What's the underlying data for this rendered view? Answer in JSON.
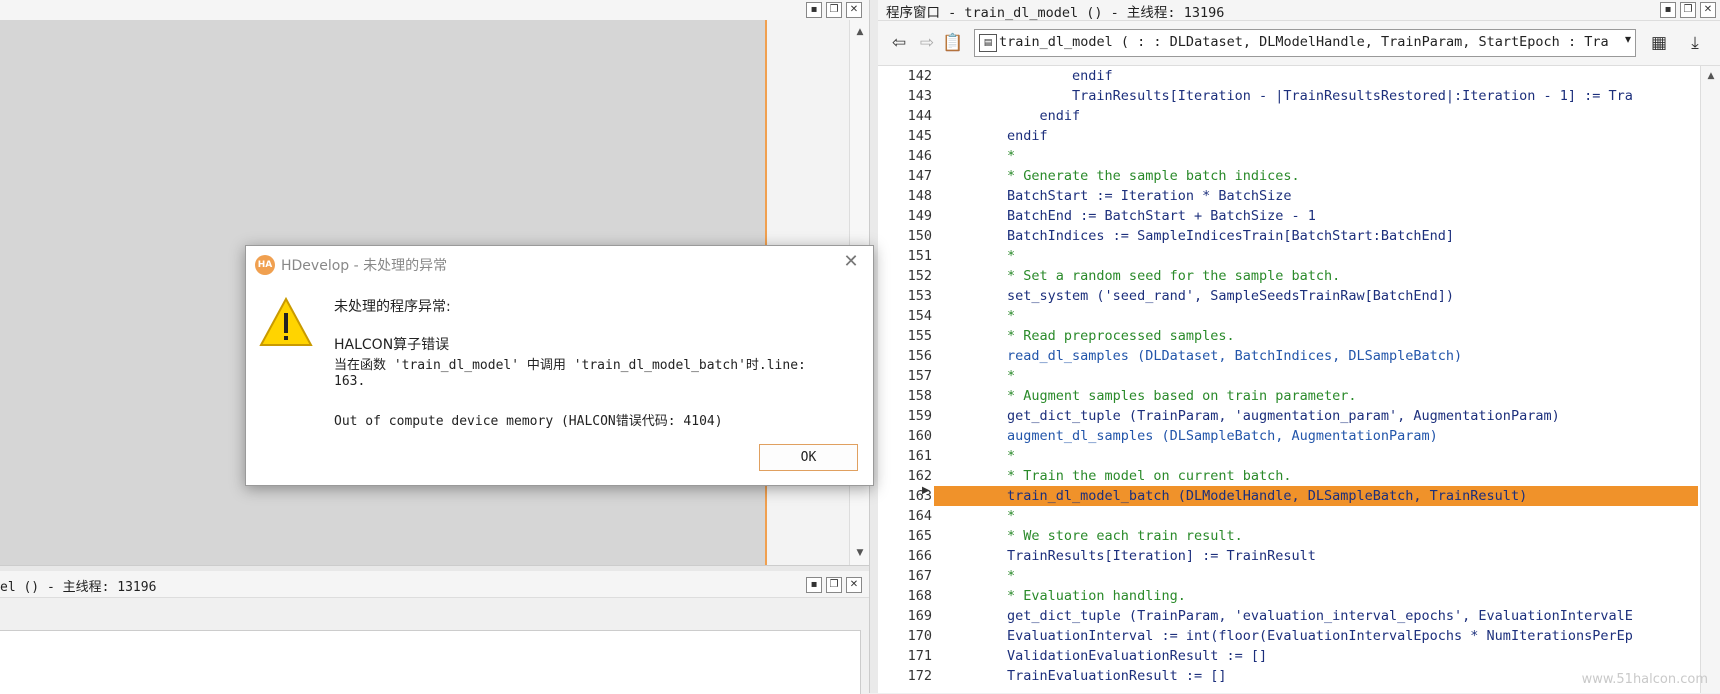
{
  "left_panel": {
    "bottom_title": "el () - 主线程: 13196"
  },
  "right_panel": {
    "title": "程序窗口 - train_dl_model () - 主线程: 13196",
    "procedure_selector": "train_dl_model ( : : DLDataset, DLModelHandle, TrainParam, StartEpoch : Trai",
    "highlighted_line": 163
  },
  "code_lines": [
    {
      "n": "142",
      "text": "                endif",
      "kind": "code"
    },
    {
      "n": "143",
      "text": "                TrainResults[Iteration - |TrainResultsRestored|:Iteration - 1] := Tra",
      "kind": "code"
    },
    {
      "n": "144",
      "text": "            endif",
      "kind": "code"
    },
    {
      "n": "145",
      "text": "        endif",
      "kind": "code"
    },
    {
      "n": "146",
      "text": "        *",
      "kind": "comment"
    },
    {
      "n": "147",
      "text": "        * Generate the sample batch indices.",
      "kind": "comment"
    },
    {
      "n": "148",
      "text": "        BatchStart := Iteration * BatchSize",
      "kind": "code"
    },
    {
      "n": "149",
      "text": "        BatchEnd := BatchStart + BatchSize - 1",
      "kind": "code"
    },
    {
      "n": "150",
      "text": "        BatchIndices := SampleIndicesTrain[BatchStart:BatchEnd]",
      "kind": "code"
    },
    {
      "n": "151",
      "text": "        *",
      "kind": "comment"
    },
    {
      "n": "152",
      "text": "        * Set a random seed for the sample batch.",
      "kind": "comment"
    },
    {
      "n": "153",
      "text": "        set_system ('seed_rand', SampleSeedsTrainRaw[BatchEnd])",
      "kind": "code"
    },
    {
      "n": "154",
      "text": "        *",
      "kind": "comment"
    },
    {
      "n": "155",
      "text": "        * Read preprocessed samples.",
      "kind": "comment"
    },
    {
      "n": "156",
      "text": "        read_dl_samples (DLDataset, BatchIndices, DLSampleBatch)",
      "kind": "proc"
    },
    {
      "n": "157",
      "text": "        *",
      "kind": "comment"
    },
    {
      "n": "158",
      "text": "        * Augment samples based on train parameter.",
      "kind": "comment"
    },
    {
      "n": "159",
      "text": "        get_dict_tuple (TrainParam, 'augmentation_param', AugmentationParam)",
      "kind": "code"
    },
    {
      "n": "160",
      "text": "        augment_dl_samples (DLSampleBatch, AugmentationParam)",
      "kind": "proc"
    },
    {
      "n": "161",
      "text": "        *",
      "kind": "comment"
    },
    {
      "n": "162",
      "text": "        * Train the model on current batch.",
      "kind": "comment"
    },
    {
      "n": "163",
      "text": "        train_dl_model_batch (DLModelHandle, DLSampleBatch, TrainResult)",
      "kind": "code"
    },
    {
      "n": "164",
      "text": "        *",
      "kind": "comment"
    },
    {
      "n": "165",
      "text": "        * We store each train result.",
      "kind": "comment"
    },
    {
      "n": "166",
      "text": "        TrainResults[Iteration] := TrainResult",
      "kind": "code"
    },
    {
      "n": "167",
      "text": "        *",
      "kind": "comment"
    },
    {
      "n": "168",
      "text": "        * Evaluation handling.",
      "kind": "comment"
    },
    {
      "n": "169",
      "text": "        get_dict_tuple (TrainParam, 'evaluation_interval_epochs', EvaluationIntervalE",
      "kind": "code"
    },
    {
      "n": "170",
      "text": "        EvaluationInterval := int(floor(EvaluationIntervalEpochs * NumIterationsPerEp",
      "kind": "code"
    },
    {
      "n": "171",
      "text": "        ValidationEvaluationResult := []",
      "kind": "code"
    },
    {
      "n": "172",
      "text": "        TrainEvaluationResult := []",
      "kind": "code"
    }
  ],
  "dialog": {
    "title": "HDevelop - 未处理的异常",
    "logo_text": "HA",
    "heading": "未处理的程序异常:",
    "line1": "HALCON算子错误",
    "line2": "当在函数 'train_dl_model' 中调用 'train_dl_model_batch'时.line:",
    "line3": "163.",
    "line4": "Out of compute device memory (HALCON错误代码: 4104)",
    "ok_label": "OK"
  },
  "watermark": "www.51halcon.com",
  "icons": {
    "back": "arrow-left-icon",
    "forward": "arrow-right-icon",
    "clipboard": "clipboard-icon",
    "procedure": "procedure-icon",
    "edit_procedure": "edit-procedure-icon",
    "pin": "pin-icon",
    "warning": "warning-icon"
  },
  "colors": {
    "highlight": "#f0922a",
    "comment": "#2a8a2a",
    "code": "#1c2f7c",
    "canvas": "#d6d6d6"
  }
}
